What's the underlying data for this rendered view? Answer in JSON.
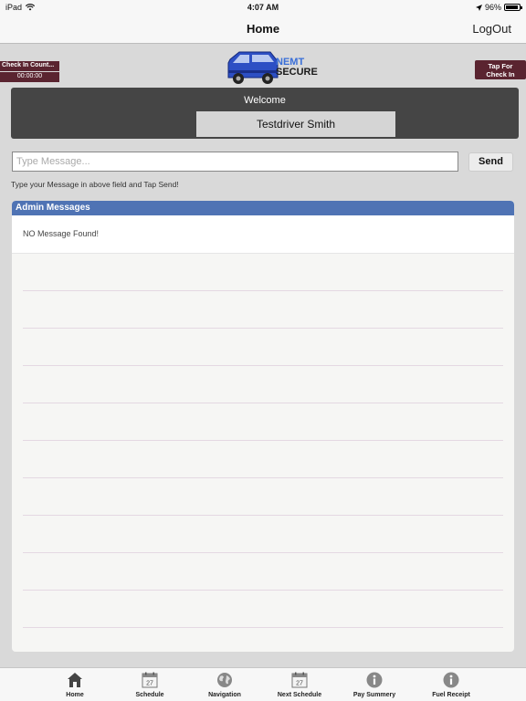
{
  "status_bar": {
    "device": "iPad",
    "time": "4:07 AM",
    "battery": "96%"
  },
  "nav": {
    "title": "Home",
    "logout_label": "LogOut"
  },
  "check_in": {
    "count_label": "Check In Count...",
    "count_value": "00:00:00",
    "tap_label_line1": "Tap For",
    "tap_label_line2": "Check In"
  },
  "logo": {
    "line1": "NEMT",
    "line2": "SECURE",
    "icon": "van-icon"
  },
  "welcome": {
    "title": "Welcome",
    "driver_name": "Testdriver Smith"
  },
  "message": {
    "placeholder": "Type Message...",
    "value": "",
    "send_label": "Send",
    "hint": "Type your Message in above field and Tap Send!"
  },
  "admin": {
    "header": "Admin Messages",
    "empty_text": "NO Message Found!"
  },
  "tabs": [
    {
      "label": "Home",
      "icon": "home-icon"
    },
    {
      "label": "Schedule",
      "icon": "calendar-icon"
    },
    {
      "label": "Navigation",
      "icon": "globe-icon"
    },
    {
      "label": "Next Schedule",
      "icon": "calendar-icon"
    },
    {
      "label": "Pay Summery",
      "icon": "info-icon"
    },
    {
      "label": "Fuel Receipt",
      "icon": "info-icon"
    }
  ],
  "calendar_day": "27",
  "colors": {
    "accent_blue": "#4f73b4",
    "maroon": "#5a2430",
    "panel_dark": "#454545"
  }
}
